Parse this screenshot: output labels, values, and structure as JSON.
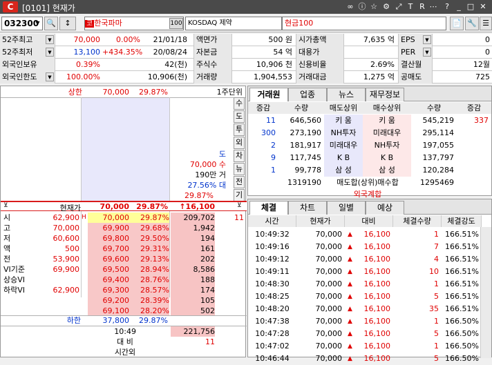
{
  "title": {
    "text": "[0101] 현재가"
  },
  "toolbar": {
    "code": "032300",
    "tag": "코",
    "name": "한국파마",
    "num": "100",
    "market": "KOSDAQ 제약",
    "price_type": "현금100"
  },
  "info": [
    [
      "52주최고",
      "70,000",
      "0.00%",
      "21/01/18",
      "액면가",
      "500 원",
      "시가총액",
      "7,635 억",
      "EPS",
      "0"
    ],
    [
      "52주최저",
      "13,100",
      "+434.35%",
      "20/08/24",
      "자본금",
      "54 억",
      "대용가",
      "",
      "PER",
      "0"
    ],
    [
      "외국인보유",
      "0.39%",
      "",
      "42(천)",
      "주식수",
      "10,906 천",
      "신용비율",
      "2.69%",
      "결산월",
      "12월"
    ],
    [
      "외국인한도",
      "100.00%",
      "",
      "10,906(천)",
      "거래량",
      "1,904,553",
      "거래대금",
      "1,275 억",
      "공매도",
      "725"
    ]
  ],
  "ob": {
    "upper_label": "상한",
    "upper_price": "70,000",
    "upper_pct": "29.87%",
    "unit": "1주단위",
    "side_tabs": [
      "수",
      "도",
      "투",
      "외",
      "차",
      "뉴",
      "전",
      "기"
    ],
    "notice": [
      "도",
      "70,000 수",
      "190만 거",
      "27.56% 대",
      "29.87%"
    ],
    "hdr_label": "현재가",
    "hdr_price": "70,000",
    "hdr_pct": "29.87%",
    "hdr_change": "↑16,100",
    "bids": [
      {
        "label": "시",
        "lval": "62,900",
        "price": "70,000",
        "pct": "29.87%",
        "qty": "209,702",
        "last": "11"
      },
      {
        "label": "고",
        "lval": "70,000",
        "price": "69,900",
        "pct": "29.68%",
        "qty": "1,942",
        "last": ""
      },
      {
        "label": "저",
        "lval": "60,600",
        "price": "69,800",
        "pct": "29.50%",
        "qty": "194",
        "last": ""
      },
      {
        "label": "액",
        "lval": "500",
        "price": "69,700",
        "pct": "29.31%",
        "qty": "161",
        "last": ""
      },
      {
        "label": "전",
        "lval": "53,900",
        "price": "69,600",
        "pct": "29.13%",
        "qty": "202",
        "last": ""
      },
      {
        "label": "VI기준",
        "lval": "69,900",
        "price": "69,500",
        "pct": "28.94%",
        "qty": "8,586",
        "last": ""
      },
      {
        "label": "상승VI",
        "lval": "",
        "price": "69,400",
        "pct": "28.76%",
        "qty": "188",
        "last": ""
      },
      {
        "label": "하락VI",
        "lval": "62,900",
        "price": "69,300",
        "pct": "28.57%",
        "qty": "174",
        "last": ""
      },
      {
        "label": "",
        "lval": "",
        "price": "69,200",
        "pct": "28.39%",
        "qty": "105",
        "last": ""
      },
      {
        "label": "",
        "lval": "",
        "price": "69,100",
        "pct": "28.20%",
        "qty": "502",
        "last": ""
      }
    ],
    "lower_label": "하한",
    "lower_price": "37,800",
    "lower_pct": "29.87%",
    "time": "10:49",
    "total_qty": "221,756",
    "cmp_label": "대 비",
    "cmp_val": "11",
    "after_label": "시간외"
  },
  "broker": {
    "tabs": [
      "거래원",
      "업종",
      "뉴스",
      "재무정보"
    ],
    "headers": [
      "증감",
      "수량",
      "매도상위",
      "매수상위",
      "수량",
      "증감"
    ],
    "rows": [
      [
        "11",
        "646,560",
        "키      움",
        "키      움",
        "545,219",
        "337"
      ],
      [
        "300",
        "273,190",
        "NH투자",
        "미래대우",
        "295,114",
        ""
      ],
      [
        "2",
        "181,917",
        "미래대우",
        "NH투자",
        "197,055",
        ""
      ],
      [
        "9",
        "117,745",
        "K        B",
        "K        B",
        "137,797",
        ""
      ],
      [
        "1",
        "99,778",
        "삼      성",
        "삼      성",
        "120,284",
        ""
      ]
    ],
    "total_sell": "1319190",
    "total_label": "매도합(상위)매수합",
    "total_buy": "1295469",
    "foreign": "외국계합"
  },
  "trades": {
    "tabs": [
      "체결",
      "차트",
      "일별",
      "예상"
    ],
    "headers": [
      "시간",
      "현재가",
      "대비",
      "체결수량",
      "체결강도"
    ],
    "rows": [
      [
        "10:49:32",
        "70,000",
        "16,100",
        "1",
        "166.51%"
      ],
      [
        "10:49:16",
        "70,000",
        "16,100",
        "7",
        "166.51%"
      ],
      [
        "10:49:12",
        "70,000",
        "16,100",
        "4",
        "166.51%"
      ],
      [
        "10:49:11",
        "70,000",
        "16,100",
        "10",
        "166.51%"
      ],
      [
        "10:48:30",
        "70,000",
        "16,100",
        "1",
        "166.51%"
      ],
      [
        "10:48:25",
        "70,000",
        "16,100",
        "5",
        "166.51%"
      ],
      [
        "10:48:20",
        "70,000",
        "16,100",
        "35",
        "166.51%"
      ],
      [
        "10:47:38",
        "70,000",
        "16,100",
        "1",
        "166.50%"
      ],
      [
        "10:47:28",
        "70,000",
        "16,100",
        "5",
        "166.50%"
      ],
      [
        "10:47:02",
        "70,000",
        "16,100",
        "1",
        "166.50%"
      ],
      [
        "10:46:44",
        "70,000",
        "16,100",
        "5",
        "166.50%"
      ]
    ]
  }
}
